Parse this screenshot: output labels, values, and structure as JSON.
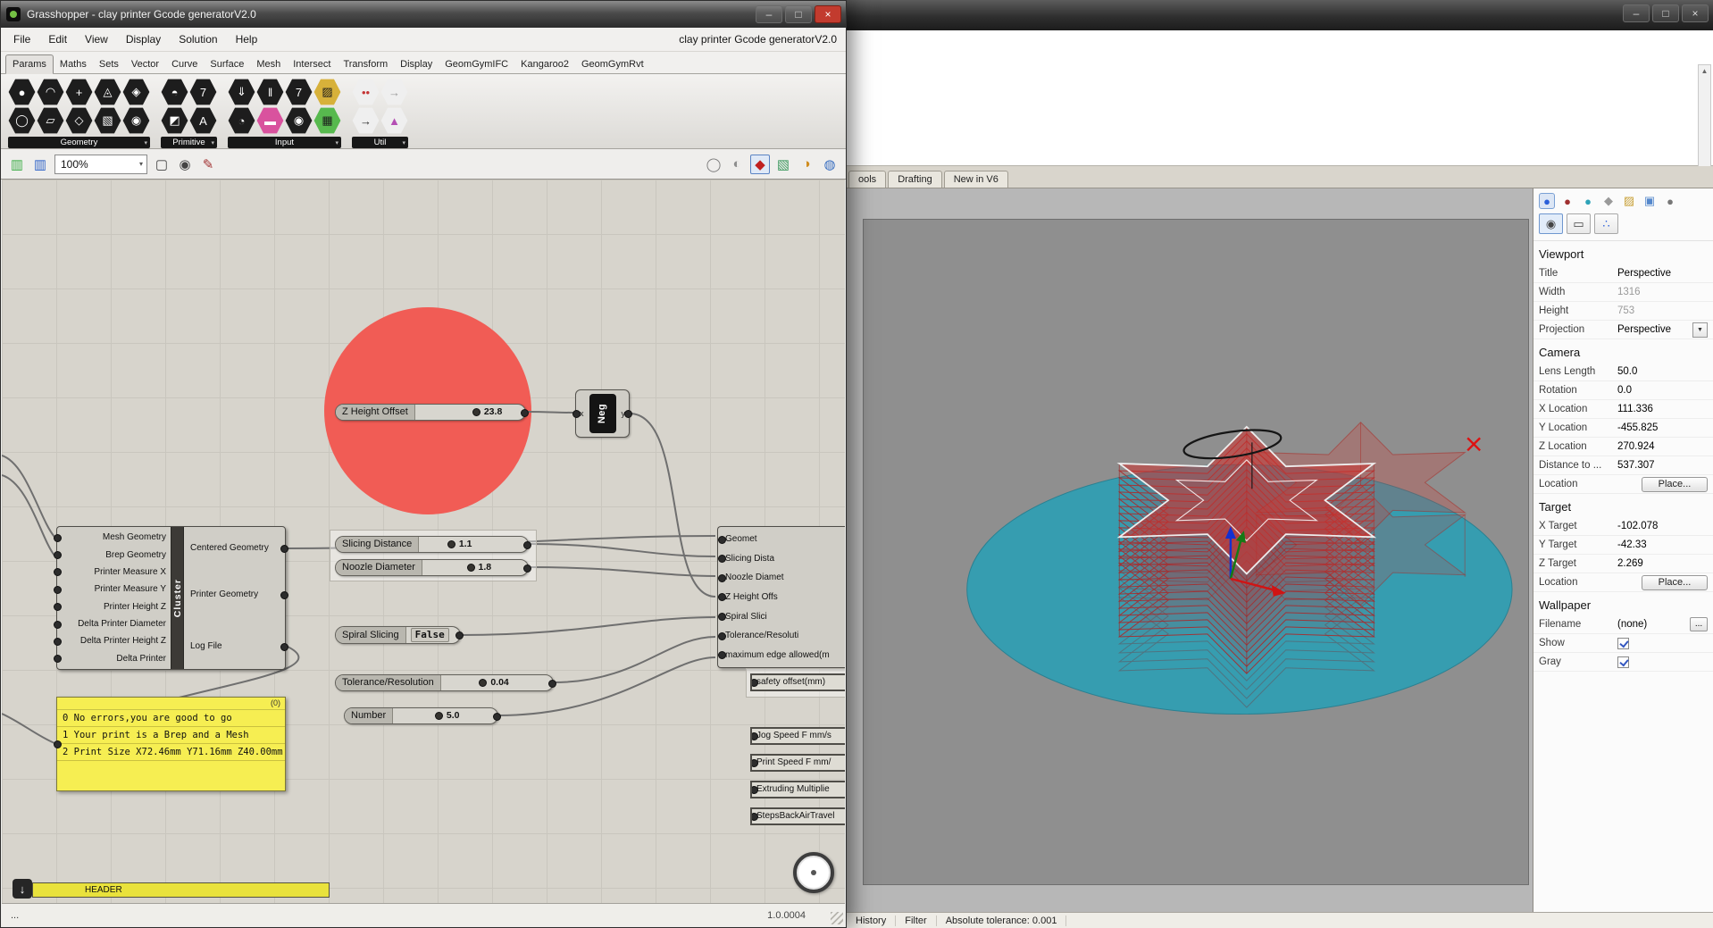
{
  "grasshopper": {
    "window_title": "Grasshopper - clay printer Gcode generatorV2.0",
    "window_buttons": [
      {
        "name": "minimize-button",
        "glyph": "–"
      },
      {
        "name": "maximize-button",
        "glyph": "□"
      },
      {
        "name": "close-button",
        "glyph": "×",
        "close": true
      }
    ],
    "menus": [
      "File",
      "Edit",
      "View",
      "Display",
      "Solution",
      "Help"
    ],
    "title_right": "clay printer Gcode generatorV2.0",
    "ribbon_tabs": [
      {
        "label": "Params",
        "active": true
      },
      {
        "label": "Maths"
      },
      {
        "label": "Sets"
      },
      {
        "label": "Vector"
      },
      {
        "label": "Curve"
      },
      {
        "label": "Surface"
      },
      {
        "label": "Mesh"
      },
      {
        "label": "Intersect"
      },
      {
        "label": "Transform"
      },
      {
        "label": "Display"
      },
      {
        "label": "GeomGymIFC"
      },
      {
        "label": "Kangaroo2"
      },
      {
        "label": "GeomGymRvt"
      }
    ],
    "toolbar": {
      "caret": "▾",
      "geometry": {
        "label": "Geometry",
        "icons": [
          {
            "name": "point-icon",
            "glyph": "●",
            "bg": "#1d1d1d",
            "fg": "#fff"
          },
          {
            "name": "circle-icon",
            "glyph": "◯",
            "bg": "#1d1d1d",
            "fg": "#fff"
          },
          {
            "name": "curve-icon",
            "glyph": "◠",
            "bg": "#1d1d1d",
            "fg": "#fff"
          },
          {
            "name": "plane-icon",
            "glyph": "▱",
            "bg": "#1d1d1d",
            "fg": "#fff"
          },
          {
            "name": "vector-icon",
            "glyph": "+",
            "bg": "#1d1d1d",
            "fg": "#fff"
          },
          {
            "name": "box-icon",
            "glyph": "◇",
            "bg": "#1d1d1d",
            "fg": "#fff"
          },
          {
            "name": "mesh-icon",
            "glyph": "◬",
            "bg": "#1d1d1d",
            "fg": "#fff"
          },
          {
            "name": "surface-icon",
            "glyph": "▧",
            "bg": "#1d1d1d",
            "fg": "#fff"
          },
          {
            "name": "brep-icon",
            "glyph": "◈",
            "bg": "#1d1d1d",
            "fg": "#fff"
          },
          {
            "name": "geometry-icon",
            "glyph": "◉",
            "bg": "#1d1d1d",
            "fg": "#fff"
          }
        ]
      },
      "primitive": {
        "label": "Primitive",
        "icons": [
          {
            "name": "boolean-icon",
            "glyph": "◓",
            "bg": "#1d1d1d",
            "fg": "#fff"
          },
          {
            "name": "colour-icon",
            "glyph": "◩",
            "bg": "#1d1d1d",
            "fg": "#fff"
          },
          {
            "name": "integer-icon",
            "glyph": "7",
            "bg": "#1d1d1d",
            "fg": "#fff"
          },
          {
            "name": "text-icon",
            "glyph": "A",
            "bg": "#1d1d1d",
            "fg": "#fff"
          }
        ]
      },
      "input": {
        "label": "Input",
        "icons": [
          {
            "name": "import-icon",
            "glyph": "⇓",
            "bg": "#1d1d1d",
            "fg": "#fff"
          },
          {
            "name": "gauge-icon",
            "glyph": "◔",
            "bg": "#1d1d1d",
            "fg": "#fff"
          },
          {
            "name": "button-icon",
            "glyph": "‖",
            "bg": "#1d1d1d",
            "fg": "#fff"
          },
          {
            "name": "slider-icon",
            "glyph": "▬",
            "bg": "#d9529e",
            "fg": "#fff"
          },
          {
            "name": "digit-icon",
            "glyph": "7",
            "bg": "#1d1d1d",
            "fg": "#fff"
          },
          {
            "name": "knob-icon",
            "glyph": "◉",
            "bg": "#1d1d1d",
            "fg": "#fff"
          },
          {
            "name": "ramp-icon",
            "glyph": "▨",
            "bg": "#d7b13a",
            "fg": "#1d1d1d"
          },
          {
            "name": "graph-icon",
            "glyph": "▦",
            "bg": "#57b94e",
            "fg": "#1d1d1d"
          }
        ]
      },
      "util": {
        "label": "Util",
        "icons": [
          {
            "name": "cherry-picker-icon",
            "glyph": "••",
            "bg": "#efefef",
            "fg": "#c43434"
          },
          {
            "name": "relay-icon",
            "glyph": "→",
            "bg": "#efefef",
            "fg": "#2b2b2b"
          },
          {
            "name": "jump-icon",
            "glyph": "→",
            "bg": "#efefef",
            "fg": "#9a9a9a"
          },
          {
            "name": "scribble-icon",
            "glyph": "▲",
            "bg": "#efefef",
            "fg": "#b44fb4"
          }
        ]
      }
    },
    "canvas_toolbar": {
      "zoom": "100%",
      "caret": "▾",
      "file_icons": [
        {
          "name": "open-file-icon",
          "glyph": "▥",
          "fg": "#3fae49"
        },
        {
          "name": "save-file-icon",
          "glyph": "▥",
          "fg": "#3064c8"
        }
      ],
      "view_icons": [
        {
          "name": "zoom-selection-icon",
          "glyph": "▢",
          "fg": "#444444"
        },
        {
          "name": "preview-icon",
          "glyph": "◉",
          "fg": "#444444"
        },
        {
          "name": "sketch-icon",
          "glyph": "✎",
          "fg": "#a33333"
        }
      ],
      "display_icons": [
        {
          "name": "wireframe-display-icon",
          "glyph": "◯",
          "fg": "#7b7b7b"
        },
        {
          "name": "shaded-display-icon",
          "glyph": "◐",
          "fg": "#8e8e8e"
        },
        {
          "name": "rendered-display-icon",
          "glyph": "◆",
          "fg": "#c02020",
          "selected": true
        },
        {
          "name": "artistic-display-icon",
          "glyph": "▧",
          "fg": "#3f9a60"
        },
        {
          "name": "ghosted-display-icon",
          "glyph": "◑",
          "fg": "#cf8c1e"
        },
        {
          "name": "raytraced-display-icon",
          "glyph": "◍",
          "fg": "#3a6fc0"
        }
      ]
    },
    "nodes": {
      "sliders": [
        {
          "label": "Z Height Offset",
          "value": "23.8"
        },
        {
          "label": "Slicing Distance",
          "value": "1.1"
        },
        {
          "label": "Noozle Diameter",
          "value": "1.8"
        },
        {
          "label": "Tolerance/Resolution",
          "value": "0.04"
        },
        {
          "label": "Number",
          "value": "5.0"
        }
      ],
      "toggle": {
        "label": "Spiral Slicing",
        "value": "False"
      },
      "neg": {
        "label": "Neg",
        "in": "x",
        "out": "y"
      },
      "cluster": {
        "tag": "Cluster",
        "inputs": [
          "Mesh Geometry",
          "Brep Geometry",
          "Printer Measure X",
          "Printer Measure Y",
          "Printer Height Z",
          "Delta Printer Diameter",
          "Delta Printer Height Z",
          "Delta Printer"
        ],
        "outputs": [
          "Centered Geometry",
          "Printer Geometry",
          "Log File"
        ]
      },
      "gcode_inputs": [
        "Geomet",
        "Slicing Dista",
        "Noozle Diamet",
        "Z Height Offs",
        "Spiral Slici",
        "Tolerance/Resoluti",
        "maximum edge allowed(m"
      ],
      "message_panel": {
        "index": "(0)",
        "lines": [
          "0 No errors,you are good to go",
          "1 Your print is a Brep and a Mesh",
          "2 Print Size X72.46mm Y71.16mm Z40.00mm"
        ]
      },
      "value_panels": [
        "safety offset(mm)",
        "Jog Speed F mm/s",
        "Print Speed F mm/",
        "Extruding Multiplie",
        "StepsBackAirTravel"
      ],
      "header_bar": "HEADER",
      "download_glyph": "↓"
    },
    "statusbar": {
      "left": "...",
      "version": "1.0.0004"
    }
  },
  "rhino": {
    "window_buttons": [
      {
        "name": "minimize-button",
        "glyph": "–"
      },
      {
        "name": "maximize-button",
        "glyph": "□"
      },
      {
        "name": "close-button",
        "glyph": "×"
      }
    ],
    "scroll_up_glyph": "▲",
    "scroll_down_glyph": "▼",
    "tabs": [
      "ools",
      "Drafting",
      "New in V6"
    ],
    "panel_icons": [
      {
        "name": "properties-tab-icon",
        "glyph": "●",
        "fg": "#2b5fd9",
        "selected": true
      },
      {
        "name": "paint-tab-icon",
        "glyph": "●",
        "fg": "#a03030"
      },
      {
        "name": "material-tab-icon",
        "glyph": "●",
        "fg": "#2fa3b8"
      },
      {
        "name": "key-icon",
        "glyph": "◆",
        "fg": "#9a9a9a"
      },
      {
        "name": "folder-icon",
        "glyph": "▨",
        "fg": "#c9a23a"
      },
      {
        "name": "image-icon",
        "glyph": "▣",
        "fg": "#5588cc"
      },
      {
        "name": "settings-icon",
        "glyph": "●",
        "fg": "#777777",
        "push_right": true
      }
    ],
    "panel_view_icons": [
      {
        "name": "camera-icon",
        "glyph": "◉",
        "selected": true
      },
      {
        "name": "viewport-settings-icon",
        "glyph": "▭"
      },
      {
        "name": "link-icon",
        "glyph": "∴",
        "fg": "#2b5fd9"
      }
    ],
    "props": {
      "dropdown_glyph": "▼",
      "viewport": {
        "title": "Viewport",
        "rows": [
          {
            "label": "Title",
            "value": "Perspective"
          },
          {
            "label": "Width",
            "value": "1316"
          },
          {
            "label": "Height",
            "value": "753"
          },
          {
            "label": "Projection",
            "value": "Perspective"
          }
        ]
      },
      "camera": {
        "title": "Camera",
        "rows": [
          {
            "label": "Lens Length",
            "value": "50.0"
          },
          {
            "label": "Rotation",
            "value": "0.0"
          },
          {
            "label": "X Location",
            "value": "111.336"
          },
          {
            "label": "Y Location",
            "value": "-455.825"
          },
          {
            "label": "Z Location",
            "value": "270.924"
          },
          {
            "label": "Distance to ...",
            "value": "537.307"
          },
          {
            "label": "Location",
            "button": "Place..."
          }
        ]
      },
      "target": {
        "title": "Target",
        "rows": [
          {
            "label": "X Target",
            "value": "-102.078"
          },
          {
            "label": "Y Target",
            "value": "-42.33"
          },
          {
            "label": "Z Target",
            "value": "2.269"
          },
          {
            "label": "Location",
            "button": "Place..."
          }
        ]
      },
      "wallpaper": {
        "title": "Wallpaper",
        "rows": [
          {
            "label": "Filename",
            "value": "(none)",
            "more": "..."
          },
          {
            "label": "Show",
            "checked": true
          },
          {
            "label": "Gray",
            "checked": true
          }
        ]
      }
    },
    "status_items": [
      "History",
      "Filter",
      "Absolute tolerance: 0.001"
    ]
  }
}
